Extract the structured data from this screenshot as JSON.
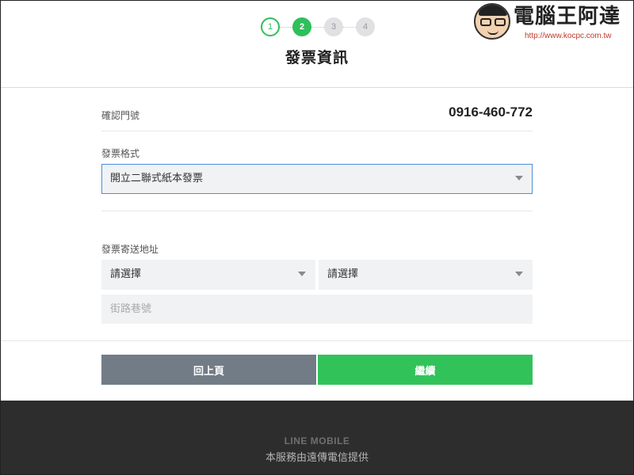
{
  "stepper": {
    "steps": [
      {
        "label": "1",
        "state": "done"
      },
      {
        "label": "2",
        "state": "active"
      },
      {
        "label": "3",
        "state": "todo"
      },
      {
        "label": "4",
        "state": "todo"
      }
    ]
  },
  "page": {
    "title": "發票資訊"
  },
  "watermark": {
    "title": "電腦王阿達",
    "url": "http://www.kocpc.com.tw"
  },
  "form": {
    "phone": {
      "label": "確認門號",
      "value": "0916-460-772"
    },
    "invoice_format": {
      "label": "發票格式",
      "selected": "開立二聯式紙本發票"
    },
    "address": {
      "label": "發票寄送地址",
      "city_select": "請選擇",
      "district_select": "請選擇",
      "street_placeholder": "街路巷號"
    }
  },
  "buttons": {
    "back": "回上頁",
    "next": "繼續"
  },
  "footer": {
    "brand": "LINE MOBILE",
    "note": "本服務由遠傳電信提供"
  },
  "colors": {
    "accent_green": "#32c25a",
    "back_button": "#717c86",
    "focus_border": "#4a90d9",
    "footer_bg": "#2d2d2d"
  }
}
